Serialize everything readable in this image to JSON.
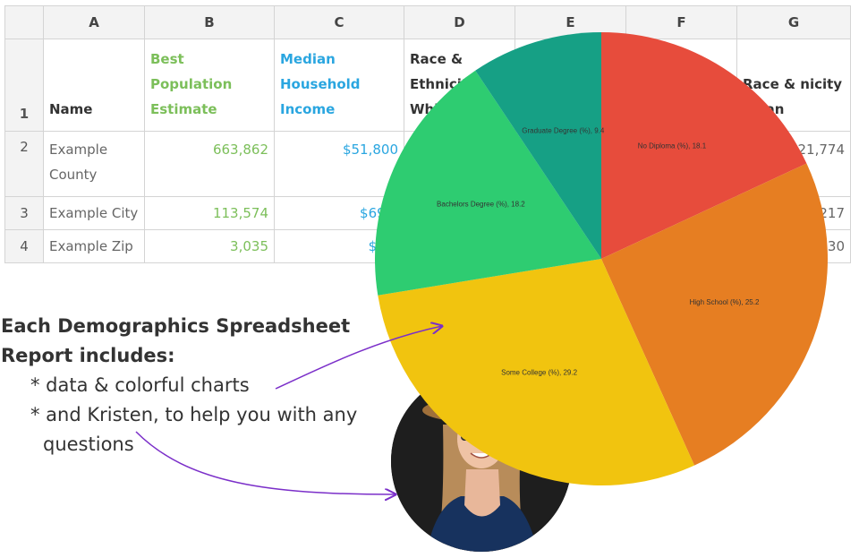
{
  "sheet": {
    "columns": [
      "A",
      "B",
      "C",
      "D",
      "E",
      "F",
      "G"
    ],
    "header_row_number": "1",
    "headers": {
      "A": "Name",
      "B": "Best Population Estimate",
      "C": "Median Household Income",
      "D": "Race & Ethnicity Whi",
      "G": "Race & nicity Asian"
    },
    "rows": [
      {
        "num": "2",
        "name": "Example County",
        "pop": "663,862",
        "income": "$51,800",
        "asian": "21,774"
      },
      {
        "num": "3",
        "name": "Example City",
        "pop": "113,574",
        "income": "$69,5",
        "asian": "217"
      },
      {
        "num": "4",
        "name": "Example Zip",
        "pop": "3,035",
        "income": "$84,",
        "asian": "30"
      }
    ],
    "colors": {
      "population": "#7cbf5a",
      "income": "#2aa6e0"
    }
  },
  "blurb": {
    "title": "Each Demographics Spreadsheet Report includes:",
    "bullet1": "* data & colorful charts",
    "bullet2": "* and Kristen, to help you with any",
    "bullet2_cont": "questions"
  },
  "chart_data": {
    "type": "pie",
    "slices": [
      {
        "label": "No Diploma (%),",
        "value": 18.1,
        "color": "#e74c3c"
      },
      {
        "label": "High School (%),",
        "value": 25.2,
        "color": "#e67e22"
      },
      {
        "label": "Some College (%),",
        "value": 29.2,
        "color": "#f1c40f"
      },
      {
        "label": "Bachelors Degree (%),",
        "value": 18.2,
        "color": "#2ecc71"
      },
      {
        "label": "Graduate Degree (%),",
        "value": 9.4,
        "color": "#16a085"
      }
    ]
  },
  "arrows": {
    "color": "#7b2fc9"
  },
  "photo": {
    "subject": "woman-in-cowboy-hat"
  }
}
